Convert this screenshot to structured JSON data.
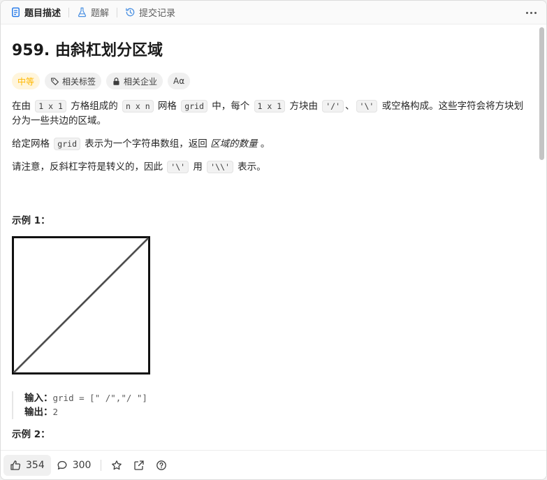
{
  "tabs": [
    {
      "label": "题目描述",
      "icon": "document-icon",
      "active": true
    },
    {
      "label": "题解",
      "icon": "flask-icon",
      "active": false
    },
    {
      "label": "提交记录",
      "icon": "history-icon",
      "active": false
    }
  ],
  "problem": {
    "title": "959. 由斜杠划分区域",
    "tags": {
      "difficulty": "中等",
      "related_tags": "相关标签",
      "related_companies": "相关企业",
      "font_toggle": "Aα"
    },
    "p1": {
      "t1": "在由 ",
      "c1": "1 x 1",
      "t2": " 方格组成的 ",
      "c2": "n x n",
      "t3": " 网格 ",
      "c3": "grid",
      "t4": " 中，每个 ",
      "c4": "1 x 1",
      "t5": " 方块由 ",
      "c5": "'/'",
      "t6": "、",
      "c6": "'\\'",
      "t7": " 或空格构成。这些字符会将方块划分为一些共边的区域。"
    },
    "p2": {
      "t1": "给定网格 ",
      "c1": "grid",
      "t2": " 表示为一个字符串数组，返回 ",
      "em": "区域的数量",
      "t3": " 。"
    },
    "p3": {
      "t1": "请注意，反斜杠字符是转义的，因此 ",
      "c1": "'\\'",
      "t2": " 用 ",
      "c2": "'\\\\'",
      "t3": " 表示。"
    },
    "example1": {
      "title": "示例 1：",
      "input_label": "输入：",
      "input_value": "grid = [\" /\",\"/ \"]",
      "output_label": "输出：",
      "output_value": "2"
    },
    "example2": {
      "title": "示例 2："
    }
  },
  "footer": {
    "likes": "354",
    "comments": "300"
  },
  "colors": {
    "medium": "#ffb800",
    "medium_bg": "#fff5dc",
    "tag_bg": "#f0f0f0"
  }
}
